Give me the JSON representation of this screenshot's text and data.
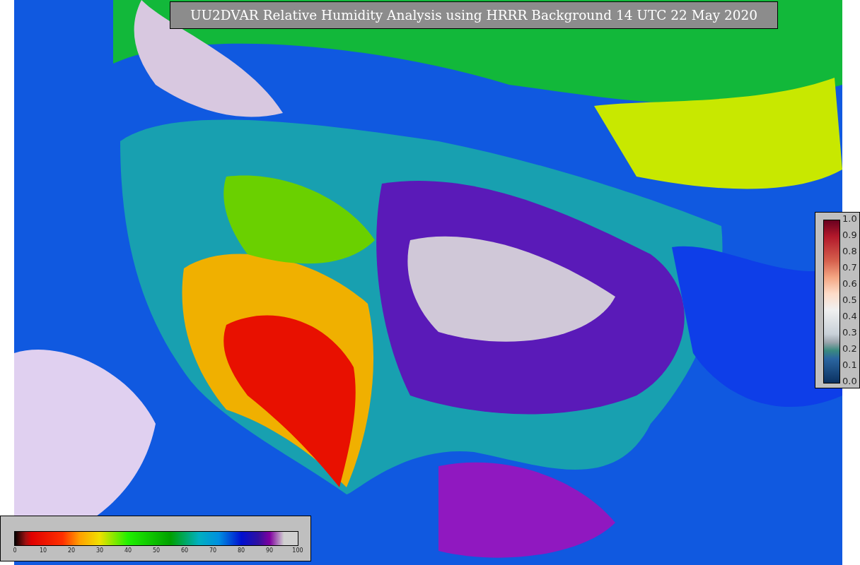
{
  "title": "UU2DVAR Relative Humidity Analysis using HRRR Background 14 UTC 22 May 2020",
  "station_colorbar": {
    "ticks": [
      "1.0",
      "0.9",
      "0.8",
      "0.7",
      "0.6",
      "0.5",
      "0.4",
      "0.3",
      "0.2",
      "0.1",
      "0.0"
    ]
  },
  "humidity_colorbar": {
    "ticks": [
      "0",
      "10",
      "20",
      "30",
      "40",
      "50",
      "60",
      "70",
      "80",
      "90",
      "100"
    ]
  }
}
